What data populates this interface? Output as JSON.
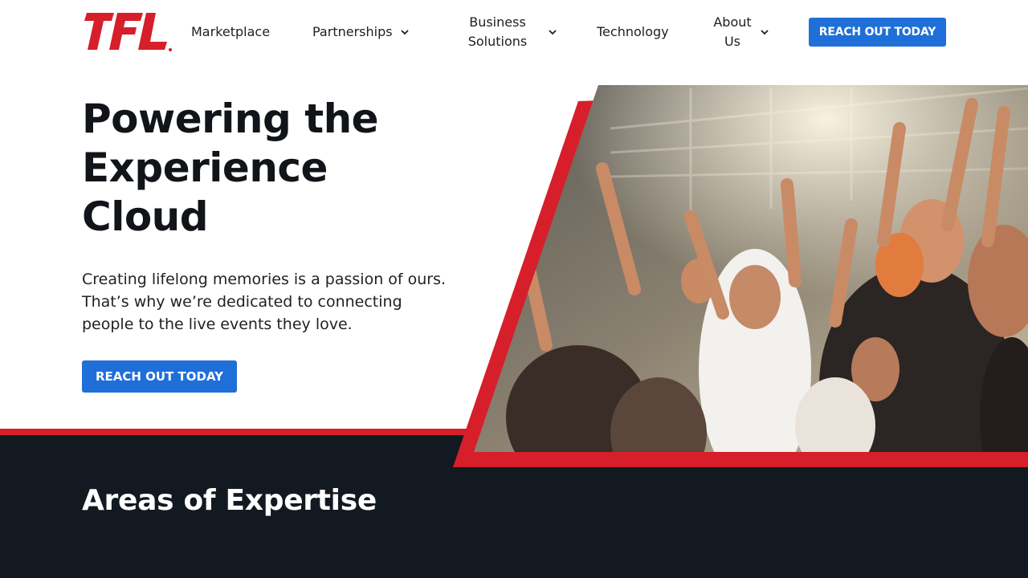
{
  "brand": {
    "logo_text": "TFL",
    "accent": "#d61f2a",
    "button_blue": "#1f6fd9",
    "dark_bg": "#121921"
  },
  "nav": {
    "items": [
      {
        "label": "Marketplace",
        "has_dropdown": false
      },
      {
        "label": "Partnerships",
        "has_dropdown": true
      },
      {
        "label_line1": "Business",
        "label_line2": "Solutions",
        "has_dropdown": true
      },
      {
        "label": "Technology",
        "has_dropdown": false
      },
      {
        "label_line1": "About",
        "label_line2": "Us",
        "has_dropdown": true
      }
    ],
    "cta_label": "REACH OUT TODAY"
  },
  "hero": {
    "title_line1": "Powering the",
    "title_line2": "Experience",
    "title_line3": "Cloud",
    "text_line1": "Creating lifelong memories is a passion of ours.",
    "text_line2": "That’s why we’re dedicated to connecting",
    "text_line3": "people to the live events they love.",
    "cta_label": "REACH OUT TODAY",
    "image_icon": "crowd-cheering-photo"
  },
  "expertise": {
    "title": "Areas of Expertise"
  }
}
